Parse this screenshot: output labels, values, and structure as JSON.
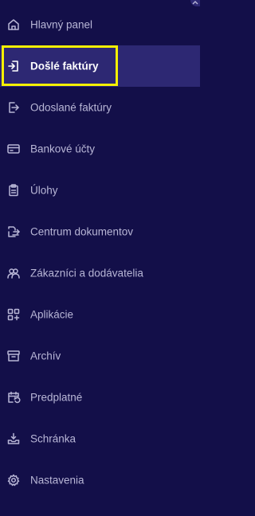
{
  "sidebar": {
    "items": [
      {
        "label": "Hlavný panel",
        "icon": "home-icon"
      },
      {
        "label": "Došlé faktúry",
        "icon": "incoming-invoice-icon",
        "active": true
      },
      {
        "label": "Odoslané faktúry",
        "icon": "outgoing-invoice-icon"
      },
      {
        "label": "Bankové účty",
        "icon": "bank-card-icon"
      },
      {
        "label": "Úlohy",
        "icon": "clipboard-icon"
      },
      {
        "label": "Centrum dokumentov",
        "icon": "document-transfer-icon"
      },
      {
        "label": "Zákazníci a dodávatelia",
        "icon": "people-icon"
      },
      {
        "label": "Aplikácie",
        "icon": "apps-grid-icon"
      },
      {
        "label": "Archív",
        "icon": "archive-box-icon"
      },
      {
        "label": "Predplatné",
        "icon": "calendar-subscription-icon"
      },
      {
        "label": "Schránka",
        "icon": "inbox-download-icon"
      },
      {
        "label": "Nastavenia",
        "icon": "gear-icon"
      }
    ]
  },
  "colors": {
    "background": "#130f49",
    "active_background": "#2d2873",
    "highlight": "#f6f000",
    "text": "#b8b6d6"
  }
}
